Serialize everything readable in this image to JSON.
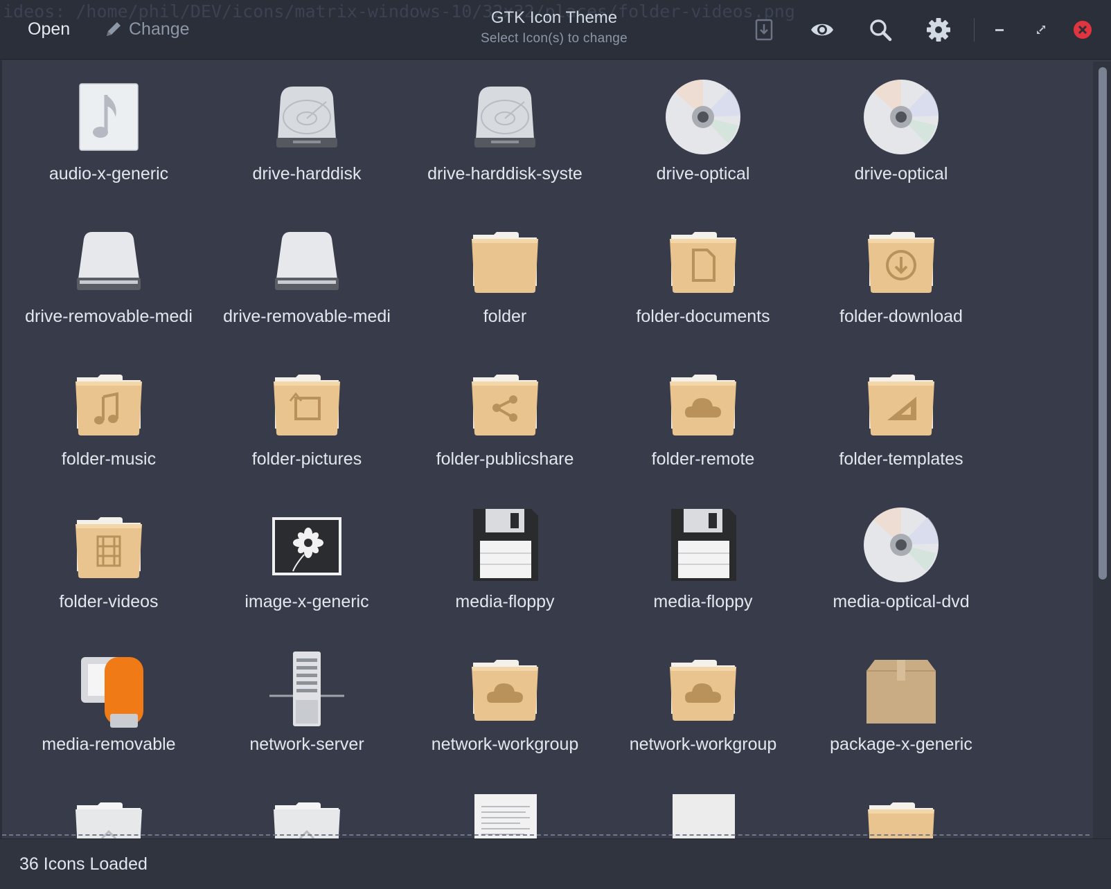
{
  "header": {
    "path_text": "ideos: /home/phil/DEV/icons/matrix-windows-10/32x32/places/folder-videos.png",
    "open_label": "Open",
    "change_label": "Change",
    "title": "GTK Icon Theme",
    "subtitle": "Select Icon(s) to change"
  },
  "toolbar_icons": [
    "download-icon",
    "eye-icon",
    "search-icon",
    "gear-icon",
    "minimize-icon",
    "maximize-icon",
    "close-icon"
  ],
  "icons": [
    {
      "label": "audio-x-generic",
      "kind": "audio"
    },
    {
      "label": "drive-harddisk",
      "kind": "harddisk"
    },
    {
      "label": "drive-harddisk-syste",
      "kind": "harddisk"
    },
    {
      "label": "drive-optical",
      "kind": "optical"
    },
    {
      "label": "drive-optical",
      "kind": "optical"
    },
    {
      "label": "drive-removable-medi",
      "kind": "removable-drive"
    },
    {
      "label": "drive-removable-medi",
      "kind": "removable-drive"
    },
    {
      "label": "folder",
      "kind": "folder"
    },
    {
      "label": "folder-documents",
      "kind": "folder-documents"
    },
    {
      "label": "folder-download",
      "kind": "folder-download"
    },
    {
      "label": "folder-music",
      "kind": "folder-music"
    },
    {
      "label": "folder-pictures",
      "kind": "folder-pictures"
    },
    {
      "label": "folder-publicshare",
      "kind": "folder-share"
    },
    {
      "label": "folder-remote",
      "kind": "folder-cloud"
    },
    {
      "label": "folder-templates",
      "kind": "folder-templates"
    },
    {
      "label": "folder-videos",
      "kind": "folder-videos"
    },
    {
      "label": "image-x-generic",
      "kind": "image"
    },
    {
      "label": "media-floppy",
      "kind": "floppy"
    },
    {
      "label": "media-floppy",
      "kind": "floppy"
    },
    {
      "label": "media-optical-dvd",
      "kind": "optical"
    },
    {
      "label": "media-removable",
      "kind": "usb"
    },
    {
      "label": "network-server",
      "kind": "server"
    },
    {
      "label": "network-workgroup",
      "kind": "folder-cloud"
    },
    {
      "label": "network-workgroup",
      "kind": "folder-cloud"
    },
    {
      "label": "package-x-generic",
      "kind": "package"
    },
    {
      "label": "",
      "kind": "folder-white"
    },
    {
      "label": "",
      "kind": "folder-white"
    },
    {
      "label": "",
      "kind": "text-doc"
    },
    {
      "label": "",
      "kind": "blank-doc"
    },
    {
      "label": "",
      "kind": "folder"
    }
  ],
  "status": {
    "text": "36 Icons Loaded"
  },
  "colors": {
    "window_bg": "#383c4a",
    "header_bg": "#2b2f3a",
    "accent_close": "#e0353f",
    "folder": "#e9c48e"
  }
}
